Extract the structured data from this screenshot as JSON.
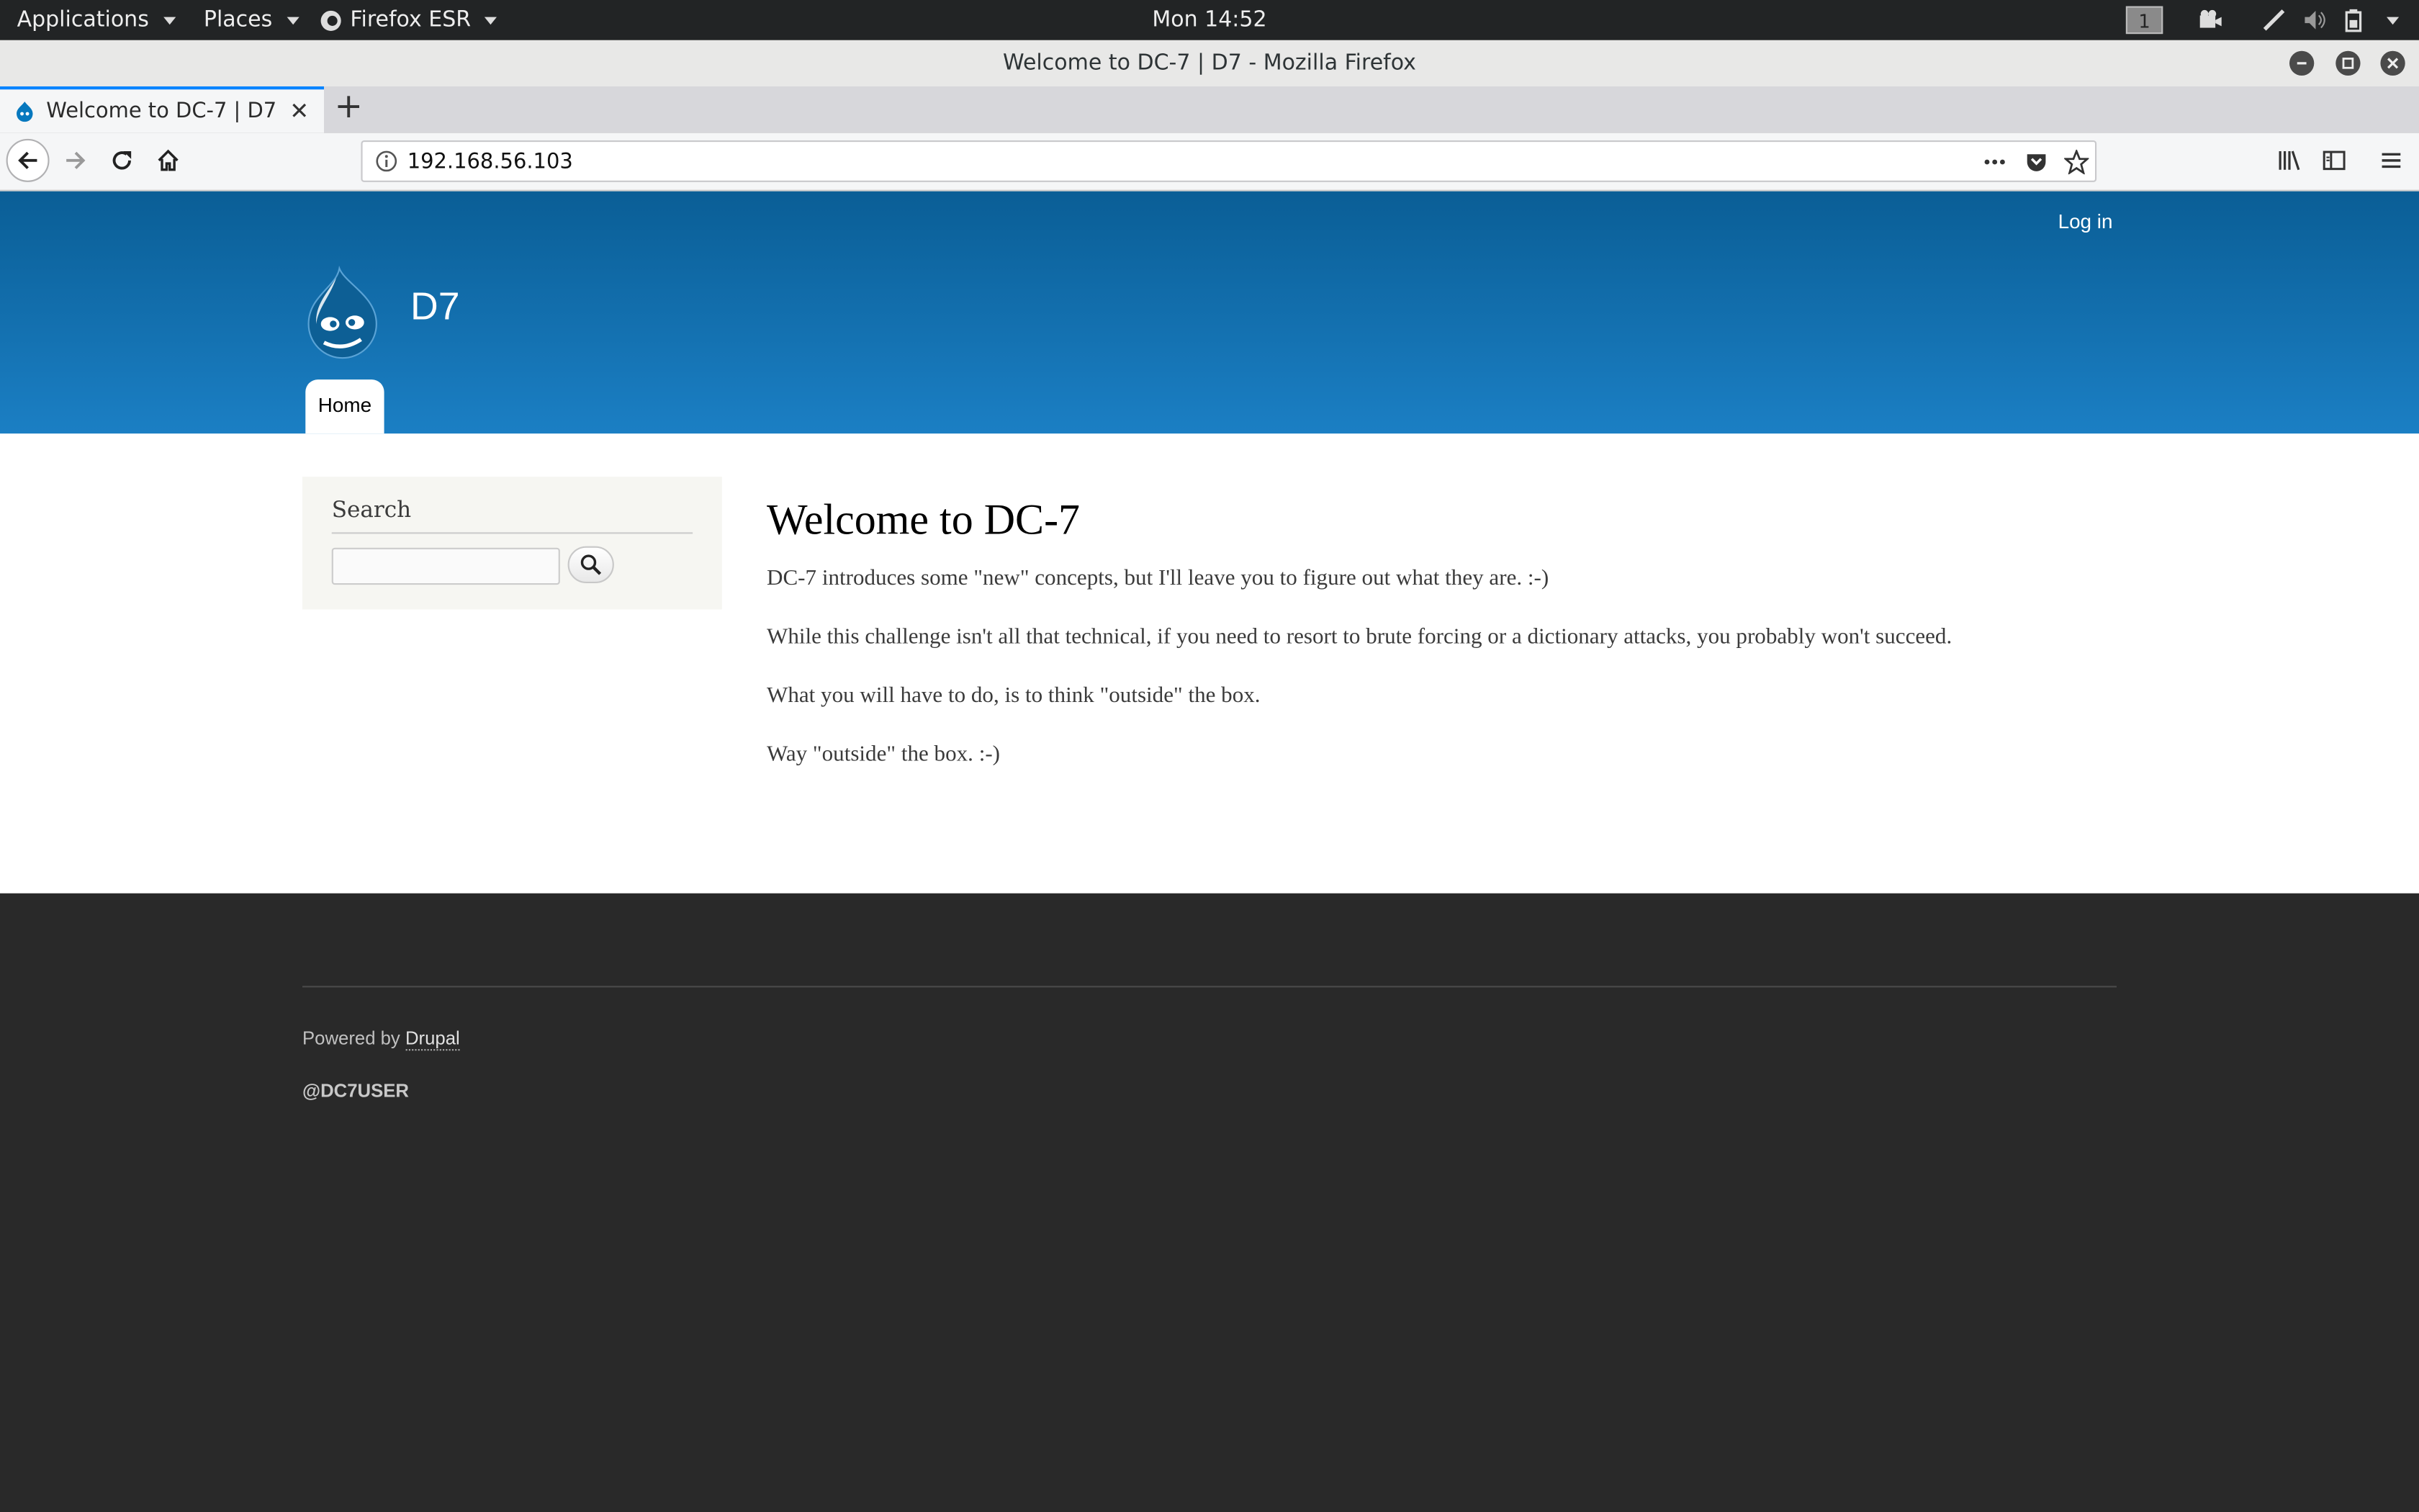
{
  "topbar": {
    "applications": "Applications",
    "places": "Places",
    "firefox": "Firefox ESR",
    "clock": "Mon 14:52",
    "workspace": "1"
  },
  "window": {
    "title": "Welcome to DC-7 | D7 - Mozilla Firefox"
  },
  "tabs": [
    {
      "title": "Welcome to DC-7 | D7"
    }
  ],
  "navbar": {
    "url": "192.168.56.103"
  },
  "site": {
    "login": "Log in",
    "name": "D7",
    "nav": [
      "Home"
    ],
    "brand_color": "#0e6fad"
  },
  "sidebar": {
    "title": "Search"
  },
  "content": {
    "heading": "Welcome to DC-7",
    "paragraphs": [
      "DC-7 introduces some \"new\" concepts, but I'll leave you to figure out what they are.  :-)",
      "While this challenge isn't all that technical, if you need to resort to brute forcing or a dictionary attacks, you probably won't succeed.",
      "What you will have to do, is to think \"outside\" the box.",
      "Way \"outside\" the box.  :-)"
    ]
  },
  "footer": {
    "powered_prefix": "Powered by",
    "powered_link": "Drupal",
    "user": "@DC7USER"
  }
}
